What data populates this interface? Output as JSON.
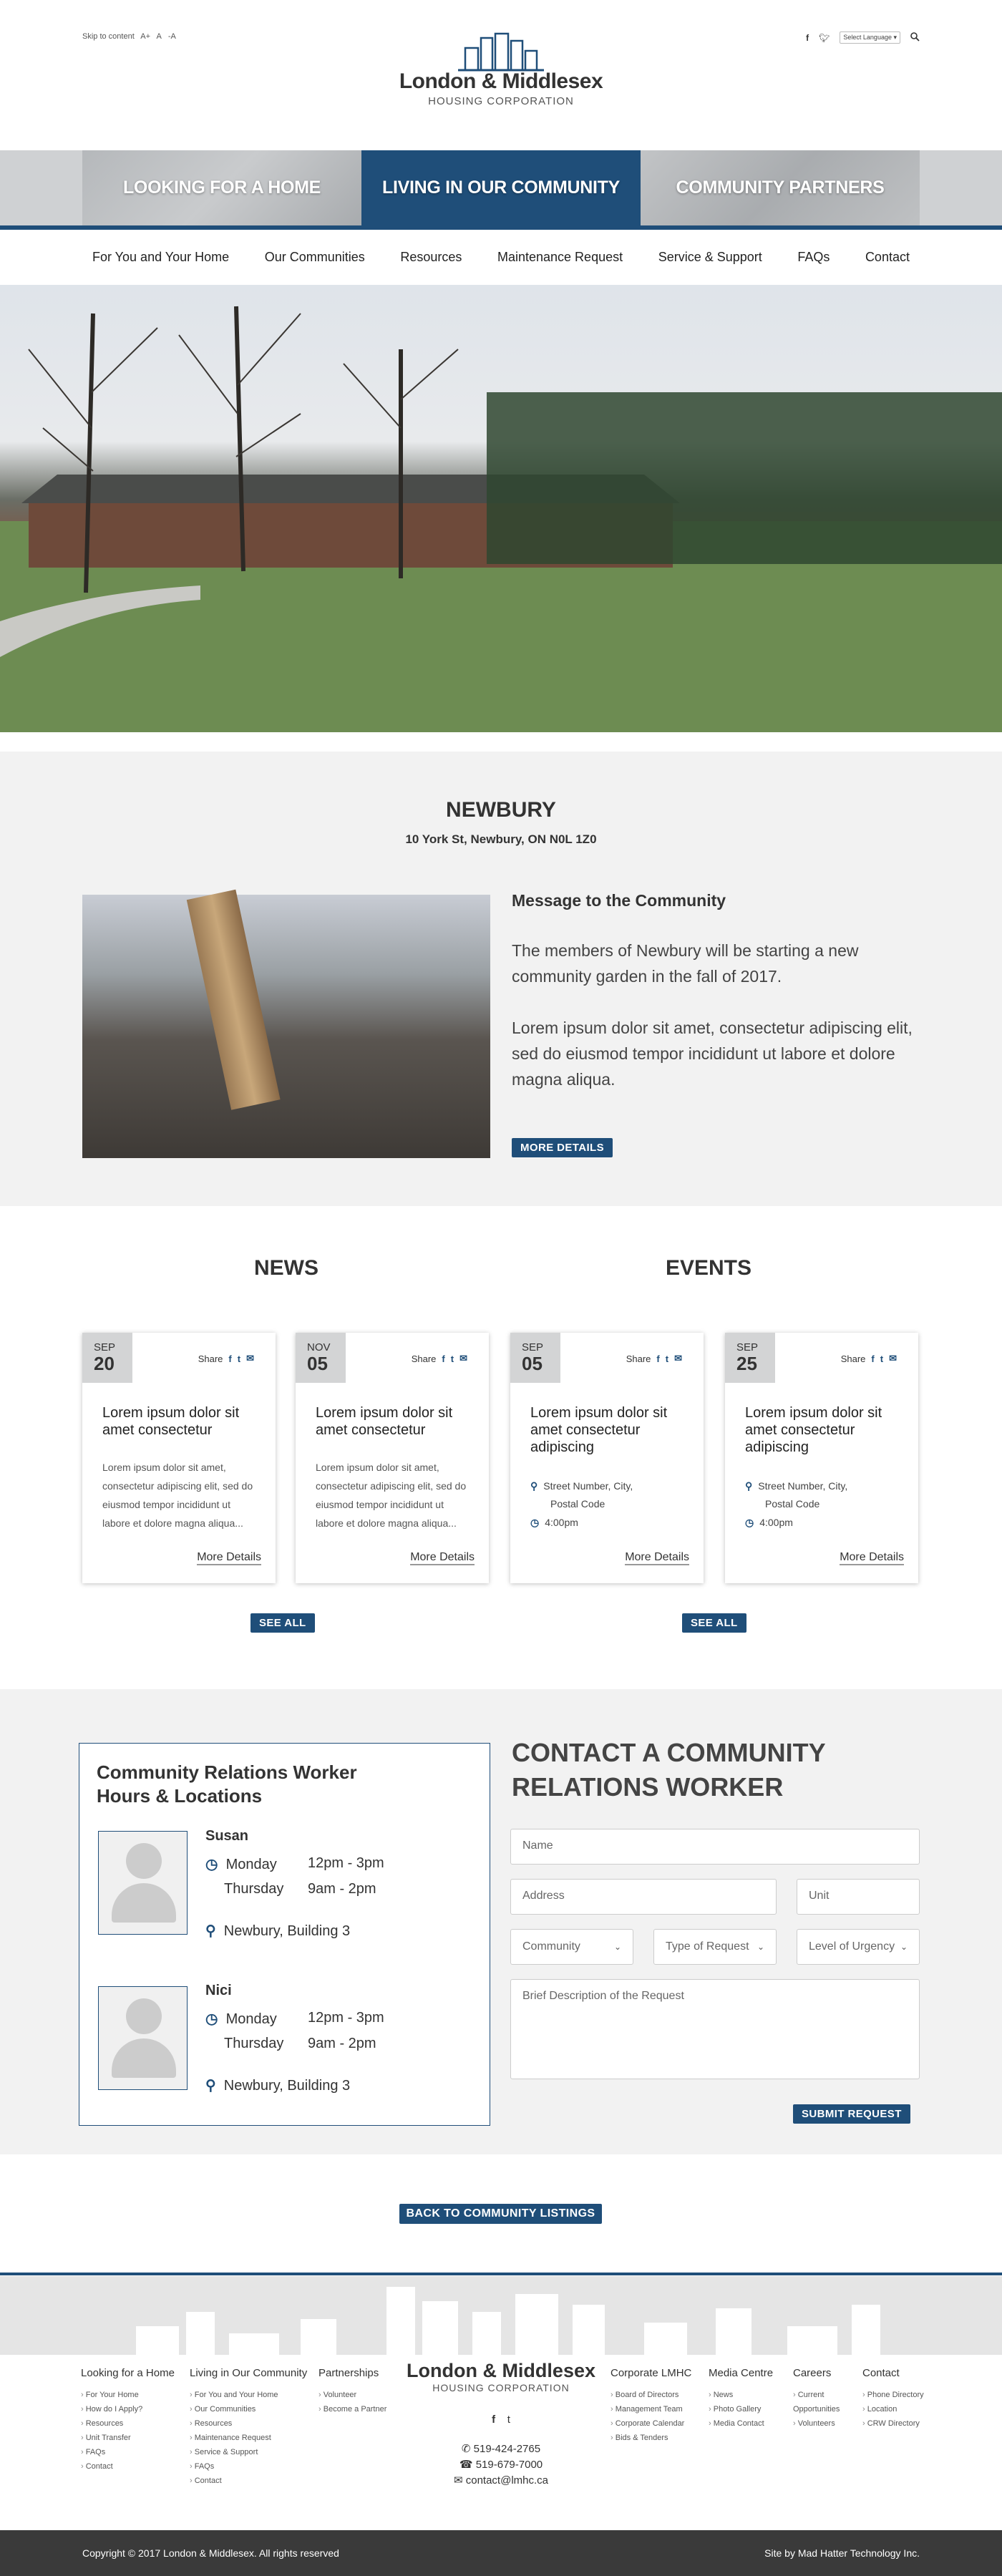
{
  "top": {
    "skip_links": [
      "Skip to content",
      "A+",
      "A",
      "-A"
    ],
    "language_label": "Select Language"
  },
  "logo": {
    "name": "London & Middlesex",
    "sub": "HOUSING CORPORATION"
  },
  "tabs": [
    "LOOKING FOR A HOME",
    "LIVING IN OUR COMMUNITY",
    "COMMUNITY PARTNERS"
  ],
  "nav": [
    "For You and Your Home",
    "Our Communities",
    "Resources",
    "Maintenance Request",
    "Service & Support",
    "FAQs",
    "Contact"
  ],
  "community": {
    "title": "NEWBURY",
    "address": "10 York St, Newbury, ON N0L 1Z0",
    "message_title": "Message to the Community",
    "p1": "The members of Newbury will be starting a new community garden in the fall of 2017.",
    "p2": "Lorem ipsum dolor sit amet, consectetur adipiscing elit, sed do eiusmod tempor incididunt ut labore et dolore magna aliqua.",
    "button": "MORE DETAILS"
  },
  "news": {
    "heading": "NEWS",
    "see_all": "SEE ALL",
    "items": [
      {
        "mon": "SEP",
        "day": "20",
        "share": "Share",
        "title": "Lorem ipsum dolor sit amet consectetur",
        "body": "Lorem ipsum dolor sit amet, consectetur adipiscing elit, sed do eiusmod tempor incididunt ut labore et dolore magna aliqua...",
        "more": "More Details"
      },
      {
        "mon": "NOV",
        "day": "05",
        "share": "Share",
        "title": "Lorem ipsum dolor sit amet consectetur",
        "body": "Lorem ipsum dolor sit amet, consectetur adipiscing elit, sed do eiusmod tempor incididunt ut labore et dolore magna aliqua...",
        "more": "More Details"
      }
    ]
  },
  "events": {
    "heading": "EVENTS",
    "see_all": "SEE ALL",
    "items": [
      {
        "mon": "SEP",
        "day": "05",
        "share": "Share",
        "title": "Lorem ipsum dolor sit amet consectetur adipiscing",
        "addr1": "Street Number, City,",
        "addr2": "Postal Code",
        "time": "4:00pm",
        "more": "More Details"
      },
      {
        "mon": "SEP",
        "day": "25",
        "share": "Share",
        "title": "Lorem ipsum dolor sit amet consectetur adipiscing",
        "addr1": "Street Number, City,",
        "addr2": "Postal Code",
        "time": "4:00pm",
        "more": "More Details"
      }
    ]
  },
  "hours": {
    "title": "Community Relations Worker Hours & Locations",
    "workers": [
      {
        "name": "Susan",
        "d1": "Monday",
        "t1": "12pm - 3pm",
        "d2": "Thursday",
        "t2": "9am  - 2pm",
        "loc": "Newbury, Building 3"
      },
      {
        "name": "Nici",
        "d1": "Monday",
        "t1": "12pm - 3pm",
        "d2": "Thursday",
        "t2": "9am  - 2pm",
        "loc": "Newbury, Building 3"
      }
    ]
  },
  "contact": {
    "title": "CONTACT A COMMUNITY RELATIONS WORKER",
    "name_ph": "Name",
    "address_ph": "Address",
    "unit_ph": "Unit",
    "community": "Community",
    "type": "Type of Request",
    "urgency": "Level of Urgency",
    "desc_ph": "Brief Description of the Request",
    "submit": "SUBMIT REQUEST"
  },
  "back": "BACK TO COMMUNITY LISTINGS",
  "footer": {
    "col1": {
      "head": "Looking for a Home",
      "items": [
        "For Your Home",
        "How do I Apply?",
        "Resources",
        "Unit Transfer",
        "FAQs",
        "Contact"
      ]
    },
    "col2": {
      "head": "Living in Our Community",
      "items": [
        "For You and Your Home",
        "Our Communities",
        "Resources",
        "Maintenance Request",
        "Service & Support",
        "FAQs",
        "Contact"
      ]
    },
    "col3": {
      "head": "Partnerships",
      "items": [
        "Volunteer",
        "Become a Partner"
      ]
    },
    "col4": {
      "head": "Corporate LMHC",
      "items": [
        "Board of Directors",
        "Management Team",
        "Corporate Calendar",
        "Bids & Tenders"
      ]
    },
    "col5": {
      "head": "Media Centre",
      "items": [
        "News",
        "Photo Gallery",
        "Media Contact"
      ]
    },
    "col6": {
      "head": "Careers",
      "items": [
        "Current Opportunities",
        "Volunteers"
      ]
    },
    "col7": {
      "head": "Contact",
      "items": [
        "Phone Directory",
        "Location",
        "CRW Directory"
      ]
    },
    "phone1": "519-424-2765",
    "phone2": "519-679-7000",
    "email": "contact@lmhc.ca",
    "copyright": "Copyright © 2017 London & Middlesex. All rights reserved",
    "credit": "Site by Mad Hatter Technology Inc."
  }
}
